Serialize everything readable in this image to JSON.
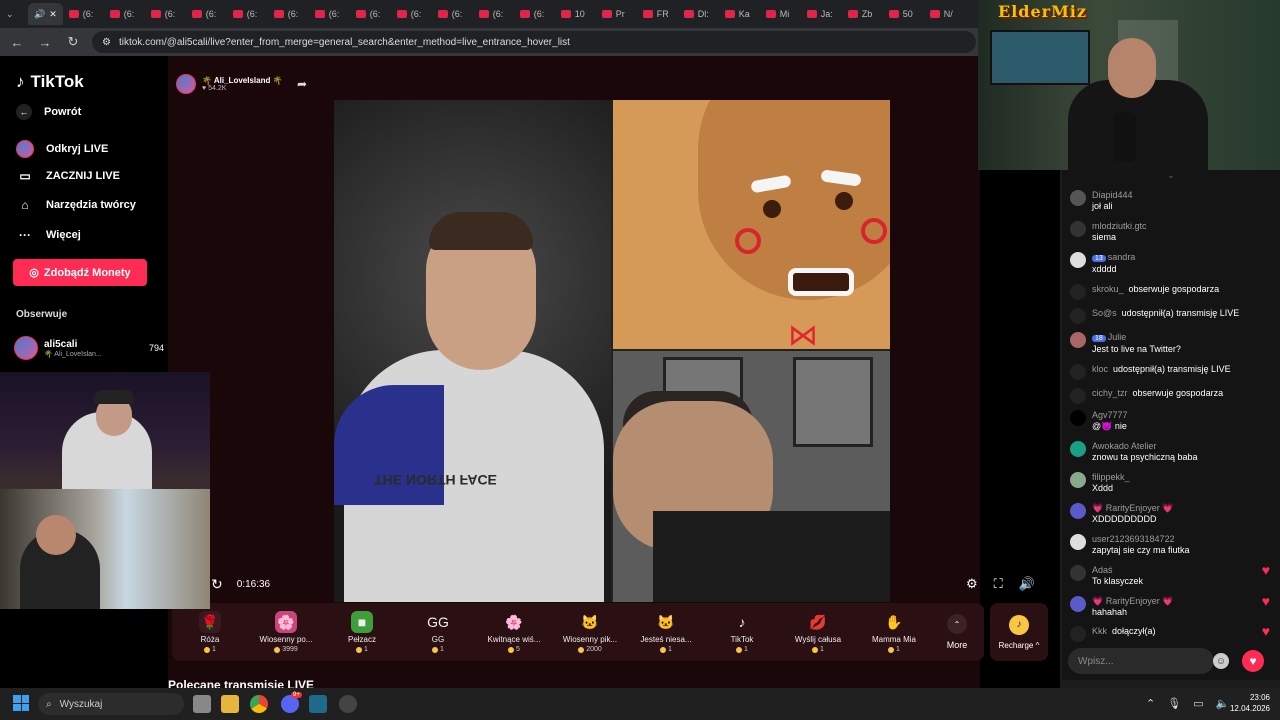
{
  "browser": {
    "tabs": [
      "(6:",
      "(6:",
      "(6:",
      "(6:",
      "(6:",
      "(6:",
      "(6:",
      "(6:",
      "(6:",
      "(6:",
      "(6:",
      "(6:",
      "10",
      "Pr",
      "FR",
      "Dl:",
      "Ka",
      "Mi",
      "Ja:",
      "Zb",
      "50",
      "N/"
    ],
    "url": "tiktok.com/@ali5cali/live?enter_from_merge=general_search&enter_method=live_entrance_hover_list"
  },
  "sidebar": {
    "logo": "TikTok",
    "back": "Powrót",
    "items": [
      {
        "label": "Odkryj LIVE",
        "icon": "live-avatar-icon"
      },
      {
        "label": "ZACZNIJ LIVE",
        "icon": "camera-icon"
      },
      {
        "label": "Narzędzia twórcy",
        "icon": "lightbulb-icon"
      },
      {
        "label": "Więcej",
        "icon": "more-dots-icon"
      }
    ],
    "coins_button": "Zdobądź Monety",
    "following_title": "Obserwuje",
    "following": {
      "name": "ali5cali",
      "sub": "🌴 Ali_LoveIslan...",
      "count": "794"
    }
  },
  "stream": {
    "name": "🌴 Ali_LoveIsland 🌴",
    "likes": "♥ 54.2K",
    "timer": "0:16:36",
    "shirt_text": "THE NORTH FACE"
  },
  "gifts": [
    {
      "name": "Róża",
      "price": "1",
      "icon": "🌹",
      "bg": "#3b1a1f"
    },
    {
      "name": "Wiosenny po...",
      "price": "3999",
      "icon": "🌸",
      "bg": "#c7477d"
    },
    {
      "name": "Pełzacz",
      "price": "1",
      "icon": "■",
      "bg": "#3f9d3a"
    },
    {
      "name": "GG",
      "price": "1",
      "icon": "GG",
      "bg": "#2b1013"
    },
    {
      "name": "Kwitnące wiś...",
      "price": "5",
      "icon": "🌸",
      "bg": "#2b1013"
    },
    {
      "name": "Wiosenny pik...",
      "price": "2000",
      "icon": "🐱",
      "bg": "#2b1013"
    },
    {
      "name": "Jesteś niesa...",
      "price": "1",
      "icon": "🐱",
      "bg": "#2b1013"
    },
    {
      "name": "TikTok",
      "price": "1",
      "icon": "♪",
      "bg": "#2b1013"
    },
    {
      "name": "Wyślij całusa",
      "price": "1",
      "icon": "💋",
      "bg": "#2b1013"
    },
    {
      "name": "Mamma Mia",
      "price": "1",
      "icon": "✋",
      "bg": "#2b1013"
    }
  ],
  "more_label": "More",
  "recharge_label": "Recharge ^",
  "polecane": "Polecane transmisje LIVE",
  "overlay_title": "ElderMiz",
  "chat": {
    "messages": [
      {
        "user": "Diapid444",
        "text": "joł ali",
        "badge": "",
        "inline": false,
        "heart": false,
        "av": "#555"
      },
      {
        "user": "mlodziutki.gtc",
        "text": "siema",
        "badge": "",
        "inline": false,
        "heart": false,
        "av": "#333"
      },
      {
        "user": "sandra",
        "text": "xdddd",
        "badge": "13",
        "inline": false,
        "heart": false,
        "av": "#ddd"
      },
      {
        "user": "skroku_",
        "text": "obserwuje gospodarza",
        "badge": "",
        "inline": true,
        "heart": false,
        "av": "#222"
      },
      {
        "user": "So@s",
        "text": "udostępnił(a) transmisję LIVE",
        "badge": "",
        "inline": true,
        "heart": false,
        "av": "#222"
      },
      {
        "user": "Julie",
        "text": "Jest to live na Twitter?",
        "badge": "18",
        "inline": false,
        "heart": false,
        "av": "#a66"
      },
      {
        "user": "kloc",
        "text": "udostępnił(a) transmisję LIVE",
        "badge": "",
        "inline": true,
        "heart": false,
        "av": "#222"
      },
      {
        "user": "cichy_tzr",
        "text": "obserwuje gospodarza",
        "badge": "",
        "inline": true,
        "heart": false,
        "av": "#222"
      },
      {
        "user": "Agv7777",
        "text": "@😈 nie",
        "badge": "",
        "inline": false,
        "heart": false,
        "av": "#000"
      },
      {
        "user": "Awokado Atelier",
        "text": "znowu ta psychiczną baba",
        "badge": "",
        "inline": false,
        "heart": false,
        "av": "#1aa087"
      },
      {
        "user": "filippekk_",
        "text": "Xddd",
        "badge": "",
        "inline": false,
        "heart": false,
        "av": "#8a8"
      },
      {
        "user": "💗 RarityEnjoyer 💗",
        "text": "XDDDDDDDDD",
        "badge": "",
        "inline": false,
        "heart": false,
        "av": "#5a5ac8"
      },
      {
        "user": "user2123693184722",
        "text": "zapytaj sie czy ma fiutka",
        "badge": "",
        "inline": false,
        "heart": false,
        "av": "#ddd"
      },
      {
        "user": "Adaś",
        "text": "To klasyczek",
        "badge": "",
        "inline": false,
        "heart": true,
        "av": "#333"
      },
      {
        "user": "💗 RarityEnjoyer 💗",
        "text": "hahahah",
        "badge": "",
        "inline": false,
        "heart": true,
        "av": "#5a5ac8"
      },
      {
        "user": "Kkk",
        "text": "dołączył(a)",
        "badge": "",
        "inline": true,
        "heart": true,
        "av": "#222"
      }
    ],
    "input_placeholder": "Wpisz..."
  },
  "taskbar": {
    "search": "Wyszukaj",
    "time": "23:06",
    "date": "12.04.2026",
    "discord_badge": "9+"
  },
  "colors": {
    "accent": "#fe2c55",
    "stage": "#1a0709",
    "coin": "#f7c744"
  }
}
